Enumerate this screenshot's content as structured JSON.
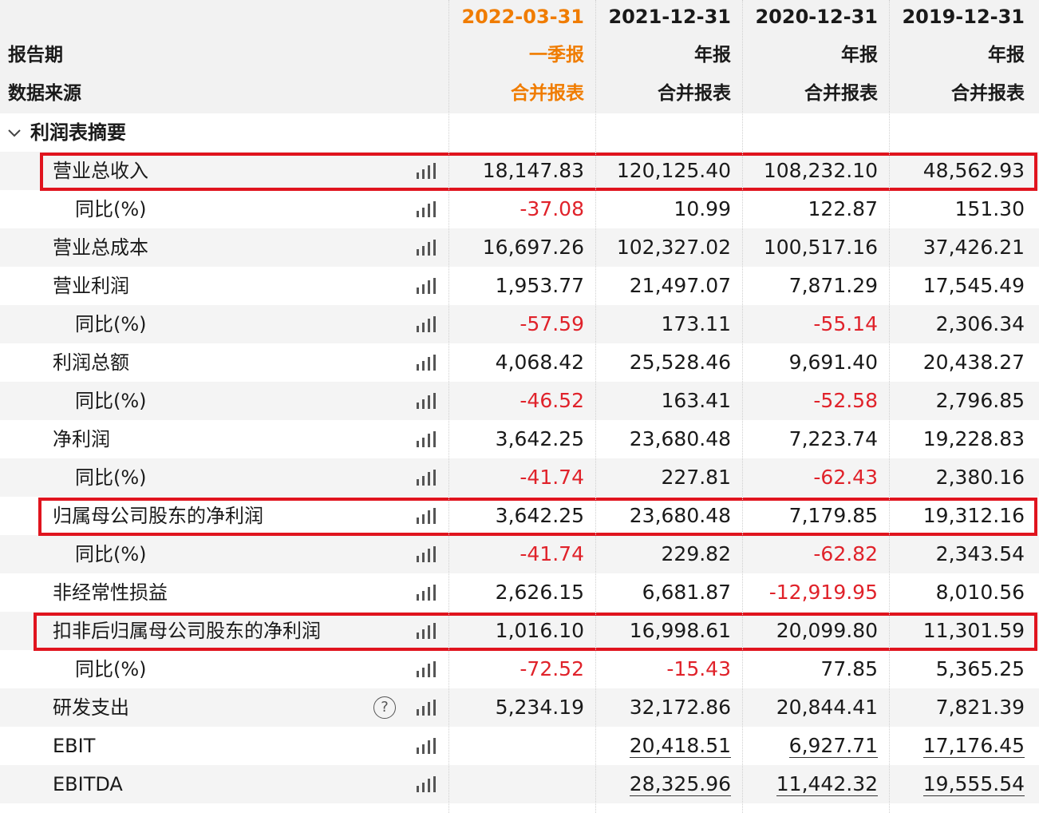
{
  "header": {
    "report_period_label": "报告期",
    "data_source_label": "数据来源",
    "columns": [
      {
        "date": "2022-03-31",
        "period_type": "一季报",
        "source": "合并报表",
        "highlight": true
      },
      {
        "date": "2021-12-31",
        "period_type": "年报",
        "source": "合并报表",
        "highlight": false
      },
      {
        "date": "2020-12-31",
        "period_type": "年报",
        "source": "合并报表",
        "highlight": false
      },
      {
        "date": "2019-12-31",
        "period_type": "年报",
        "source": "合并报表",
        "highlight": false
      }
    ]
  },
  "section": {
    "title": "利润表摘要",
    "icon": "chevron-down-icon"
  },
  "rows": [
    {
      "label": "营业总收入",
      "indent": 1,
      "values": [
        "18,147.83",
        "120,125.40",
        "108,232.10",
        "48,562.93"
      ],
      "neg": [
        false,
        false,
        false,
        false
      ],
      "boxed": true
    },
    {
      "label": "同比(%)",
      "indent": 2,
      "values": [
        "-37.08",
        "10.99",
        "122.87",
        "151.30"
      ],
      "neg": [
        true,
        false,
        false,
        false
      ]
    },
    {
      "label": "营业总成本",
      "indent": 1,
      "values": [
        "16,697.26",
        "102,327.02",
        "100,517.16",
        "37,426.21"
      ],
      "neg": [
        false,
        false,
        false,
        false
      ]
    },
    {
      "label": "营业利润",
      "indent": 1,
      "values": [
        "1,953.77",
        "21,497.07",
        "7,871.29",
        "17,545.49"
      ],
      "neg": [
        false,
        false,
        false,
        false
      ]
    },
    {
      "label": "同比(%)",
      "indent": 2,
      "values": [
        "-57.59",
        "173.11",
        "-55.14",
        "2,306.34"
      ],
      "neg": [
        true,
        false,
        true,
        false
      ]
    },
    {
      "label": "利润总额",
      "indent": 1,
      "values": [
        "4,068.42",
        "25,528.46",
        "9,691.40",
        "20,438.27"
      ],
      "neg": [
        false,
        false,
        false,
        false
      ]
    },
    {
      "label": "同比(%)",
      "indent": 2,
      "values": [
        "-46.52",
        "163.41",
        "-52.58",
        "2,796.85"
      ],
      "neg": [
        true,
        false,
        true,
        false
      ]
    },
    {
      "label": "净利润",
      "indent": 1,
      "values": [
        "3,642.25",
        "23,680.48",
        "7,223.74",
        "19,228.83"
      ],
      "neg": [
        false,
        false,
        false,
        false
      ]
    },
    {
      "label": "同比(%)",
      "indent": 2,
      "values": [
        "-41.74",
        "227.81",
        "-62.43",
        "2,380.16"
      ],
      "neg": [
        true,
        false,
        true,
        false
      ]
    },
    {
      "label": "归属母公司股东的净利润",
      "indent": 1,
      "values": [
        "3,642.25",
        "23,680.48",
        "7,179.85",
        "19,312.16"
      ],
      "neg": [
        false,
        false,
        false,
        false
      ],
      "boxed": true
    },
    {
      "label": "同比(%)",
      "indent": 2,
      "values": [
        "-41.74",
        "229.82",
        "-62.82",
        "2,343.54"
      ],
      "neg": [
        true,
        false,
        true,
        false
      ]
    },
    {
      "label": "非经常性损益",
      "indent": 1,
      "values": [
        "2,626.15",
        "6,681.87",
        "-12,919.95",
        "8,010.56"
      ],
      "neg": [
        false,
        false,
        true,
        false
      ]
    },
    {
      "label": "扣非后归属母公司股东的净利润",
      "indent": 1,
      "values": [
        "1,016.10",
        "16,998.61",
        "20,099.80",
        "11,301.59"
      ],
      "neg": [
        false,
        false,
        false,
        false
      ],
      "boxed": true
    },
    {
      "label": "同比(%)",
      "indent": 2,
      "values": [
        "-72.52",
        "-15.43",
        "77.85",
        "5,365.25"
      ],
      "neg": [
        true,
        true,
        false,
        false
      ]
    },
    {
      "label": "研发支出",
      "indent": 1,
      "values": [
        "5,234.19",
        "32,172.86",
        "20,844.41",
        "7,821.39"
      ],
      "neg": [
        false,
        false,
        false,
        false
      ],
      "help_icon": "?"
    },
    {
      "label": "EBIT",
      "indent": 1,
      "values": [
        "",
        "20,418.51",
        "6,927.71",
        "17,176.45"
      ],
      "neg": [
        false,
        false,
        false,
        false
      ],
      "underline": true
    },
    {
      "label": "EBITDA",
      "indent": 1,
      "values": [
        "",
        "28,325.96",
        "11,442.32",
        "19,555.54"
      ],
      "neg": [
        false,
        false,
        false,
        false
      ],
      "underline": true
    }
  ],
  "colors": {
    "accent_orange": "#f07c00",
    "negative_red": "#e0222a",
    "highlight_box": "#e0141e"
  },
  "row_icon": "bar-chart-icon"
}
